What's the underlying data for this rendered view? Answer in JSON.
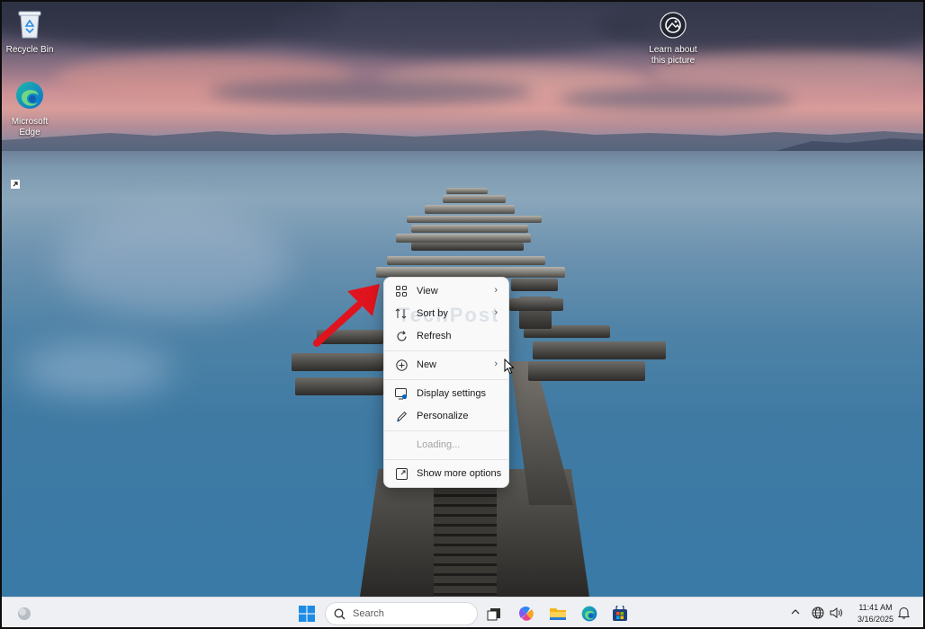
{
  "desktop": {
    "icons": [
      {
        "label": "Recycle Bin",
        "icon": "recycle-bin-icon"
      },
      {
        "label": "Microsoft Edge",
        "icon": "edge-icon"
      },
      {
        "label": "Learn about this picture",
        "icon": "camera-icon"
      }
    ],
    "watermark": "TechPost"
  },
  "context_menu": {
    "items": [
      {
        "label": "View",
        "icon": "grid-icon",
        "submenu": true
      },
      {
        "label": "Sort by",
        "icon": "sort-icon",
        "submenu": true
      },
      {
        "label": "Refresh",
        "icon": "refresh-icon",
        "submenu": false
      },
      {
        "label": "New",
        "icon": "plus-circle-icon",
        "submenu": true
      },
      {
        "label": "Display settings",
        "icon": "display-icon",
        "submenu": false
      },
      {
        "label": "Personalize",
        "icon": "pen-icon",
        "submenu": false
      },
      {
        "label": "Loading...",
        "icon": "",
        "submenu": false,
        "disabled": true
      },
      {
        "label": "Show more options",
        "icon": "expand-icon",
        "submenu": false
      }
    ]
  },
  "taskbar": {
    "search_placeholder": "Search",
    "apps": [
      "start-icon",
      "copilot-icon",
      "task-view-icon",
      "file-explorer-icon",
      "edge-icon",
      "store-icon"
    ],
    "clock_time": "11:41 AM",
    "clock_date": "3/16/2025"
  },
  "colors": {
    "accent": "#0067c0",
    "arrow": "#e0141e",
    "menu_bg": "#f9f9f9",
    "taskbar_bg": "#eef0f3"
  }
}
